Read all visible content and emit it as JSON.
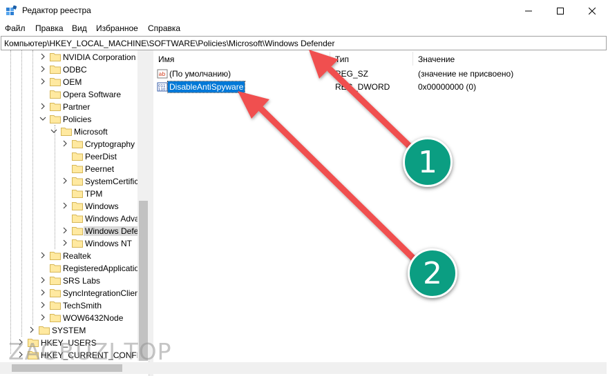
{
  "window": {
    "title": "Редактор реестра"
  },
  "menu": {
    "items": [
      "Файл",
      "Правка",
      "Вид",
      "Избранное",
      "Справка"
    ]
  },
  "address": {
    "path": "Компьютер\\HKEY_LOCAL_MACHINE\\SOFTWARE\\Policies\\Microsoft\\Windows Defender"
  },
  "tree": {
    "items": [
      {
        "label": "NVIDIA Corporation",
        "level": 3,
        "expander": "collapsed"
      },
      {
        "label": "ODBC",
        "level": 3,
        "expander": "collapsed"
      },
      {
        "label": "OEM",
        "level": 3,
        "expander": "collapsed"
      },
      {
        "label": "Opera Software",
        "level": 3,
        "expander": "none"
      },
      {
        "label": "Partner",
        "level": 3,
        "expander": "collapsed"
      },
      {
        "label": "Policies",
        "level": 3,
        "expander": "expanded"
      },
      {
        "label": "Microsoft",
        "level": 4,
        "expander": "expanded"
      },
      {
        "label": "Cryptography",
        "level": 5,
        "expander": "collapsed"
      },
      {
        "label": "PeerDist",
        "level": 5,
        "expander": "none"
      },
      {
        "label": "Peernet",
        "level": 5,
        "expander": "none"
      },
      {
        "label": "SystemCertificates",
        "level": 5,
        "expander": "collapsed"
      },
      {
        "label": "TPM",
        "level": 5,
        "expander": "none"
      },
      {
        "label": "Windows",
        "level": 5,
        "expander": "collapsed"
      },
      {
        "label": "Windows Advanced Threat Protection",
        "level": 5,
        "expander": "none"
      },
      {
        "label": "Windows Defender",
        "level": 5,
        "expander": "collapsed",
        "selected": true
      },
      {
        "label": "Windows NT",
        "level": 5,
        "expander": "collapsed"
      },
      {
        "label": "Realtek",
        "level": 3,
        "expander": "collapsed"
      },
      {
        "label": "RegisteredApplications",
        "level": 3,
        "expander": "none"
      },
      {
        "label": "SRS Labs",
        "level": 3,
        "expander": "collapsed"
      },
      {
        "label": "SyncIntegrationClients",
        "level": 3,
        "expander": "collapsed"
      },
      {
        "label": "TechSmith",
        "level": 3,
        "expander": "collapsed"
      },
      {
        "label": "WOW6432Node",
        "level": 3,
        "expander": "collapsed"
      },
      {
        "label": "SYSTEM",
        "level": 2,
        "expander": "collapsed"
      },
      {
        "label": "HKEY_USERS",
        "level": 1,
        "expander": "collapsed"
      },
      {
        "label": "HKEY_CURRENT_CONFIG",
        "level": 1,
        "expander": "collapsed"
      }
    ]
  },
  "list": {
    "columns": [
      "Имя",
      "Тип",
      "Значение"
    ],
    "rows": [
      {
        "name": "(По умолчанию)",
        "type": "REG_SZ",
        "value": "(значение не присвоено)",
        "icon": "string-value-icon",
        "selected": false
      },
      {
        "name": "DisableAntiSpyware",
        "type": "REG_DWORD",
        "value": "0x00000000 (0)",
        "icon": "dword-value-icon",
        "selected": true
      }
    ]
  },
  "annotations": {
    "badges": [
      "1",
      "2"
    ],
    "watermark": "ZAGRUZI.TOP",
    "arrow_color": "#f05050",
    "badge_color": "#0b9e82"
  }
}
